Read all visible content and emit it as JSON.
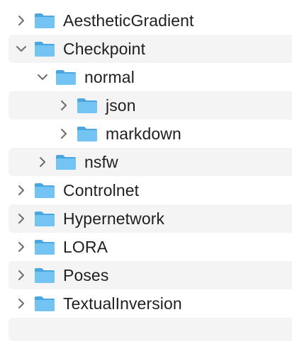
{
  "tree": {
    "items": [
      {
        "label": "AestheticGradient",
        "depth": 0,
        "expanded": false,
        "icon": "folder-icon",
        "chevron": "chevron-right-icon"
      },
      {
        "label": "Checkpoint",
        "depth": 0,
        "expanded": true,
        "icon": "folder-icon",
        "chevron": "chevron-down-icon"
      },
      {
        "label": "normal",
        "depth": 1,
        "expanded": true,
        "icon": "folder-icon",
        "chevron": "chevron-down-icon"
      },
      {
        "label": "json",
        "depth": 2,
        "expanded": false,
        "icon": "folder-icon",
        "chevron": "chevron-right-icon"
      },
      {
        "label": "markdown",
        "depth": 2,
        "expanded": false,
        "icon": "folder-icon",
        "chevron": "chevron-right-icon"
      },
      {
        "label": "nsfw",
        "depth": 1,
        "expanded": false,
        "icon": "folder-icon",
        "chevron": "chevron-right-icon"
      },
      {
        "label": "Controlnet",
        "depth": 0,
        "expanded": false,
        "icon": "folder-icon",
        "chevron": "chevron-right-icon"
      },
      {
        "label": "Hypernetwork",
        "depth": 0,
        "expanded": false,
        "icon": "folder-icon",
        "chevron": "chevron-right-icon"
      },
      {
        "label": "LORA",
        "depth": 0,
        "expanded": false,
        "icon": "folder-icon",
        "chevron": "chevron-right-icon"
      },
      {
        "label": "Poses",
        "depth": 0,
        "expanded": false,
        "icon": "folder-icon",
        "chevron": "chevron-right-icon"
      },
      {
        "label": "TextualInversion",
        "depth": 0,
        "expanded": false,
        "icon": "folder-icon",
        "chevron": "chevron-right-icon"
      }
    ]
  },
  "colors": {
    "folder_body": "#5fb6ec",
    "folder_tab": "#4aa6df",
    "folder_front": "#74c4f3",
    "stripe": "#f4f4f4",
    "text": "#1f1f1f",
    "chevron": "#6e6e6e"
  }
}
